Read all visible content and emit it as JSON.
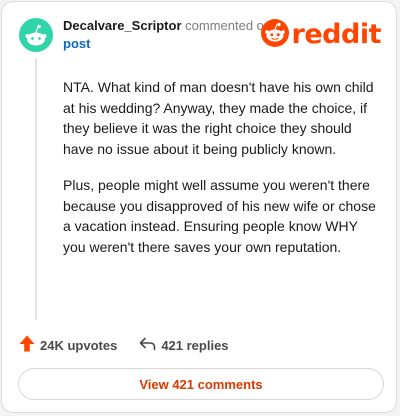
{
  "comment": {
    "username": "Decalvare_Scriptor",
    "action_text": "commented on",
    "target_text": "post",
    "paragraphs": [
      "NTA. What kind of man doesn't have his own child at his wedding? Anyway, they made the choice, if they believe it was the right choice they should have no issue about it being publicly known.",
      "Plus, people might well assume you weren't there because you disapproved of his new wife or chose a vacation instead. Ensuring people know WHY you weren't there saves your own reputation."
    ]
  },
  "brand": {
    "wordmark": "reddit",
    "color": "#ff4500"
  },
  "stats": {
    "upvotes_label": "24K upvotes",
    "replies_label": "421 replies"
  },
  "footer": {
    "view_comments_label": "View 421 comments"
  },
  "icons": {
    "avatar": "snoo-avatar-icon",
    "logo": "reddit-snoo-icon",
    "upvote": "upvote-arrow-icon",
    "reply": "reply-arrow-icon"
  },
  "colors": {
    "avatar_bg": "#2fd4a8",
    "link": "#0b66c2",
    "button_text": "#d93a00",
    "upvote": "#ff4500"
  }
}
